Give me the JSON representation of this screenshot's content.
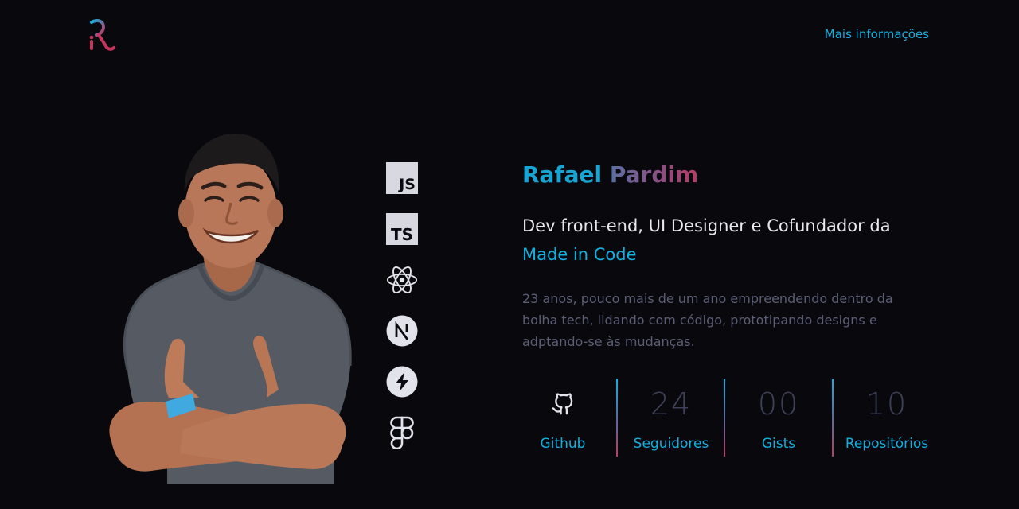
{
  "header": {
    "logo_icon": "rp-monogram-logo",
    "more_info_label": "Mais informações"
  },
  "profile": {
    "first_name": "Rafael",
    "last_name": "Pardim",
    "role_line": "Dev front-end, UI Designer e Cofundador da",
    "company": "Made in Code",
    "bio": "23 anos, pouco mais de um ano empreendendo dentro da bolha tech, lidando com código, prototipando designs e adptando-se às mudanças."
  },
  "tech_stack": [
    {
      "icon": "javascript-icon",
      "label": "JS"
    },
    {
      "icon": "typescript-icon",
      "label": "TS"
    },
    {
      "icon": "react-icon"
    },
    {
      "icon": "nextjs-icon"
    },
    {
      "icon": "bolt-icon"
    },
    {
      "icon": "figma-icon"
    }
  ],
  "stats": [
    {
      "icon": "github-icon",
      "label": "Github"
    },
    {
      "value": "24",
      "label": "Seguidores"
    },
    {
      "value": "00",
      "label": "Gists"
    },
    {
      "value": "10",
      "label": "Repositórios"
    }
  ],
  "colors": {
    "background": "#08080d",
    "accent": "#12b0e0",
    "accent_secondary": "#b43f63",
    "muted_text": "#5c5e76"
  }
}
